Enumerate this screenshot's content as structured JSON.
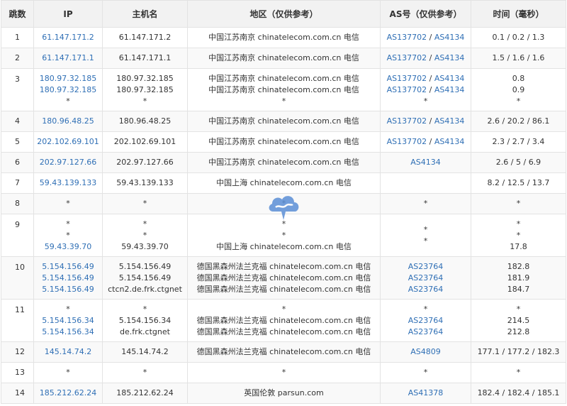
{
  "headers": {
    "hop": "跳数",
    "ip": "IP",
    "hostname": "主机名",
    "region": "地区（仅供参考）",
    "as": "AS号（仅供参考）",
    "time": "时间（毫秒）"
  },
  "rows": [
    {
      "hop": "1",
      "ip": [
        "61.147.171.2"
      ],
      "host": [
        "61.147.171.2"
      ],
      "region": [
        "中国江苏南京 chinatelecom.com.cn 电信"
      ],
      "as": [
        [
          "AS137702",
          "AS4134"
        ]
      ],
      "time": [
        "0.1 / 0.2 / 1.3"
      ]
    },
    {
      "hop": "2",
      "ip": [
        "61.147.171.1"
      ],
      "host": [
        "61.147.171.1"
      ],
      "region": [
        "中国江苏南京 chinatelecom.com.cn 电信"
      ],
      "as": [
        [
          "AS137702",
          "AS4134"
        ]
      ],
      "time": [
        "1.5 / 1.6 / 1.6"
      ]
    },
    {
      "hop": "3",
      "ip": [
        "180.97.32.185",
        "180.97.32.185",
        "*"
      ],
      "host": [
        "180.97.32.185",
        "180.97.32.185",
        "*"
      ],
      "region": [
        "中国江苏南京 chinatelecom.com.cn 电信",
        "中国江苏南京 chinatelecom.com.cn 电信",
        "*"
      ],
      "as": [
        [
          "AS137702",
          "AS4134"
        ],
        [
          "AS137702",
          "AS4134"
        ],
        [
          "*"
        ]
      ],
      "time": [
        "0.8",
        "0.9",
        "*"
      ]
    },
    {
      "hop": "4",
      "ip": [
        "180.96.48.25"
      ],
      "host": [
        "180.96.48.25"
      ],
      "region": [
        "中国江苏南京 chinatelecom.com.cn 电信"
      ],
      "as": [
        [
          "AS137702",
          "AS4134"
        ]
      ],
      "time": [
        "2.6 / 20.2 / 86.1"
      ]
    },
    {
      "hop": "5",
      "ip": [
        "202.102.69.101"
      ],
      "host": [
        "202.102.69.101"
      ],
      "region": [
        "中国江苏南京 chinatelecom.com.cn 电信"
      ],
      "as": [
        [
          "AS137702",
          "AS4134"
        ]
      ],
      "time": [
        "2.3 / 2.7 / 3.4"
      ]
    },
    {
      "hop": "6",
      "ip": [
        "202.97.127.66"
      ],
      "host": [
        "202.97.127.66"
      ],
      "region": [
        "中国江苏南京 chinatelecom.com.cn 电信"
      ],
      "as": [
        [
          "AS4134"
        ]
      ],
      "time": [
        "2.6 / 5 / 6.9"
      ]
    },
    {
      "hop": "7",
      "ip": [
        "59.43.139.133"
      ],
      "host": [
        "59.43.139.133"
      ],
      "region": [
        "中国上海 chinatelecom.com.cn 电信"
      ],
      "as": [],
      "time": [
        "8.2 / 12.5 / 13.7"
      ]
    },
    {
      "hop": "8",
      "ip": [
        "*"
      ],
      "host": [
        "*"
      ],
      "region": [
        "*"
      ],
      "as": [
        [
          "*"
        ]
      ],
      "time": [
        "*"
      ]
    },
    {
      "hop": "9",
      "ip": [
        "*",
        "*",
        "59.43.39.70"
      ],
      "host": [
        "*",
        "*",
        "59.43.39.70"
      ],
      "region": [
        "*",
        "*",
        "中国上海 chinatelecom.com.cn 电信"
      ],
      "as": [
        [
          "*"
        ],
        [
          "*"
        ]
      ],
      "time": [
        "*",
        "*",
        "17.8"
      ]
    },
    {
      "hop": "10",
      "ip": [
        "5.154.156.49",
        "5.154.156.49",
        "5.154.156.49"
      ],
      "host": [
        "5.154.156.49",
        "5.154.156.49",
        "ctcn2.de.frk.ctgnet"
      ],
      "region": [
        "德国黑森州法兰克福 chinatelecom.com.cn 电信",
        "德国黑森州法兰克福 chinatelecom.com.cn 电信",
        "德国黑森州法兰克福 chinatelecom.com.cn 电信"
      ],
      "as": [
        [
          "AS23764"
        ],
        [
          "AS23764"
        ],
        [
          "AS23764"
        ]
      ],
      "time": [
        "182.8",
        "181.9",
        "184.7"
      ]
    },
    {
      "hop": "11",
      "ip": [
        "*",
        "5.154.156.34",
        "5.154.156.34"
      ],
      "host": [
        "*",
        "5.154.156.34",
        "de.frk.ctgnet"
      ],
      "region": [
        "*",
        "德国黑森州法兰克福 chinatelecom.com.cn 电信",
        "德国黑森州法兰克福 chinatelecom.com.cn 电信"
      ],
      "as": [
        [
          "*"
        ],
        [
          "AS23764"
        ],
        [
          "AS23764"
        ]
      ],
      "time": [
        "*",
        "214.5",
        "212.8"
      ]
    },
    {
      "hop": "12",
      "ip": [
        "145.14.74.2"
      ],
      "host": [
        "145.14.74.2"
      ],
      "region": [
        "德国黑森州法兰克福 chinatelecom.com.cn 电信"
      ],
      "as": [
        [
          "AS4809"
        ]
      ],
      "time": [
        "177.1 / 177.2 / 182.3"
      ]
    },
    {
      "hop": "13",
      "ip": [
        "*"
      ],
      "host": [
        "*"
      ],
      "region": [
        "*"
      ],
      "as": [
        [
          "*"
        ]
      ],
      "time": [
        "*"
      ]
    },
    {
      "hop": "14",
      "ip": [
        "185.212.62.24"
      ],
      "host": [
        "185.212.62.24"
      ],
      "region": [
        "英国伦敦 parsun.com"
      ],
      "as": [
        [
          "AS41378"
        ]
      ],
      "time": [
        "182.4 / 182.4 / 185.1"
      ]
    }
  ],
  "colors": {
    "link": "#2f6fb5",
    "header_bg": "#f2f2f2",
    "stripe_bg": "#f9f9f9",
    "border": "#e3e3e3",
    "watermark": "#5b8fd6"
  },
  "watermark_icon": "cloud-logo-icon"
}
